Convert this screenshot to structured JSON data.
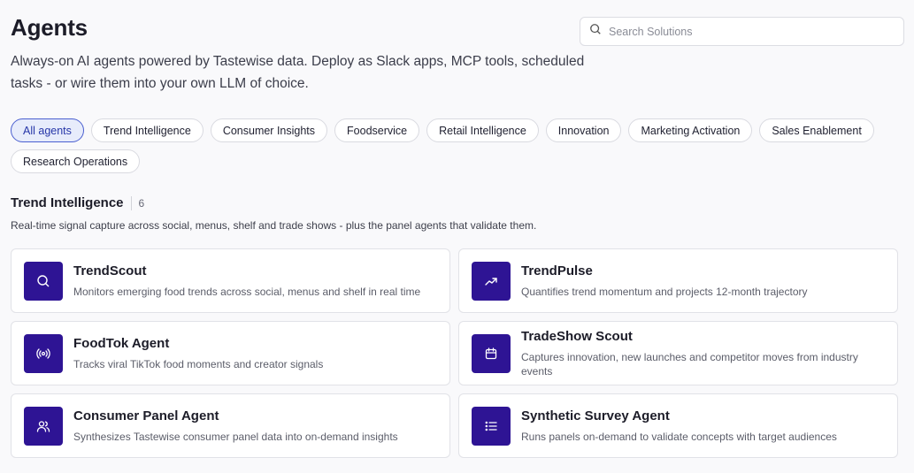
{
  "header": {
    "title": "Agents",
    "subtitle": "Always-on AI agents powered by Tastewise data. Deploy as Slack apps, MCP tools, scheduled tasks - or wire them into your own LLM of choice."
  },
  "search": {
    "placeholder": "Search Solutions",
    "icon": "search-icon"
  },
  "filters": [
    {
      "label": "All agents",
      "active": true
    },
    {
      "label": "Trend Intelligence",
      "active": false
    },
    {
      "label": "Consumer Insights",
      "active": false
    },
    {
      "label": "Foodservice",
      "active": false
    },
    {
      "label": "Retail Intelligence",
      "active": false
    },
    {
      "label": "Innovation",
      "active": false
    },
    {
      "label": "Marketing Activation",
      "active": false
    },
    {
      "label": "Sales Enablement",
      "active": false
    },
    {
      "label": "Research Operations",
      "active": false
    }
  ],
  "section": {
    "title": "Trend Intelligence",
    "count": "6",
    "description": "Real-time signal capture across social, menus, shelf and trade shows - plus the panel agents that validate them."
  },
  "agents": [
    {
      "name": "TrendScout",
      "description": "Monitors emerging food trends across social, menus and shelf in real time",
      "icon": "search-icon"
    },
    {
      "name": "TrendPulse",
      "description": "Quantifies trend momentum and projects 12-month trajectory",
      "icon": "trending-up-icon"
    },
    {
      "name": "FoodTok Agent",
      "description": "Tracks viral TikTok food moments and creator signals",
      "icon": "broadcast-icon"
    },
    {
      "name": "TradeShow Scout",
      "description": "Captures innovation, new launches and competitor moves from industry events",
      "icon": "calendar-icon"
    },
    {
      "name": "Consumer Panel Agent",
      "description": "Synthesizes Tastewise consumer panel data into on-demand insights",
      "icon": "users-icon"
    },
    {
      "name": "Synthetic Survey Agent",
      "description": "Runs panels on-demand to validate concepts with target audiences",
      "icon": "list-icon"
    }
  ],
  "colors": {
    "icon_bg": "#2e1494",
    "chip_active_bg": "#e7ecfb",
    "chip_active_border": "#4a5fd0"
  }
}
